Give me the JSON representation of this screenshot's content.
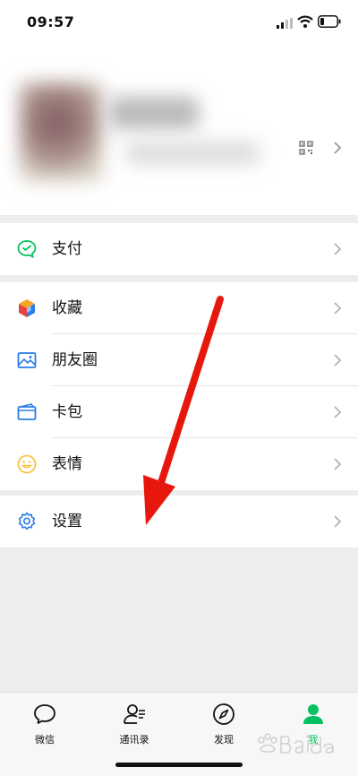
{
  "status_bar": {
    "time": "09:57"
  },
  "profile": {},
  "menu_groups": [
    {
      "items": [
        {
          "label": "支付",
          "icon": "wechat-pay-icon"
        }
      ]
    },
    {
      "items": [
        {
          "label": "收藏",
          "icon": "favorites-cube-icon"
        },
        {
          "label": "朋友圈",
          "icon": "moments-picture-icon"
        },
        {
          "label": "卡包",
          "icon": "card-wallet-icon"
        },
        {
          "label": "表情",
          "icon": "sticker-smile-icon"
        }
      ]
    },
    {
      "items": [
        {
          "label": "设置",
          "icon": "settings-gear-icon"
        }
      ]
    }
  ],
  "tab_bar": {
    "tabs": [
      {
        "label": "微信",
        "icon": "chat-bubble-icon",
        "active": false
      },
      {
        "label": "通讯录",
        "icon": "contacts-icon",
        "active": false
      },
      {
        "label": "发现",
        "icon": "compass-icon",
        "active": false
      },
      {
        "label": "我",
        "icon": "person-icon",
        "active": true
      }
    ]
  },
  "colors": {
    "accent_green": "#07c160",
    "annotation_red": "#e8170e",
    "background": "#ededed"
  },
  "annotation": {
    "type": "red-arrow",
    "points_to": "设置"
  }
}
